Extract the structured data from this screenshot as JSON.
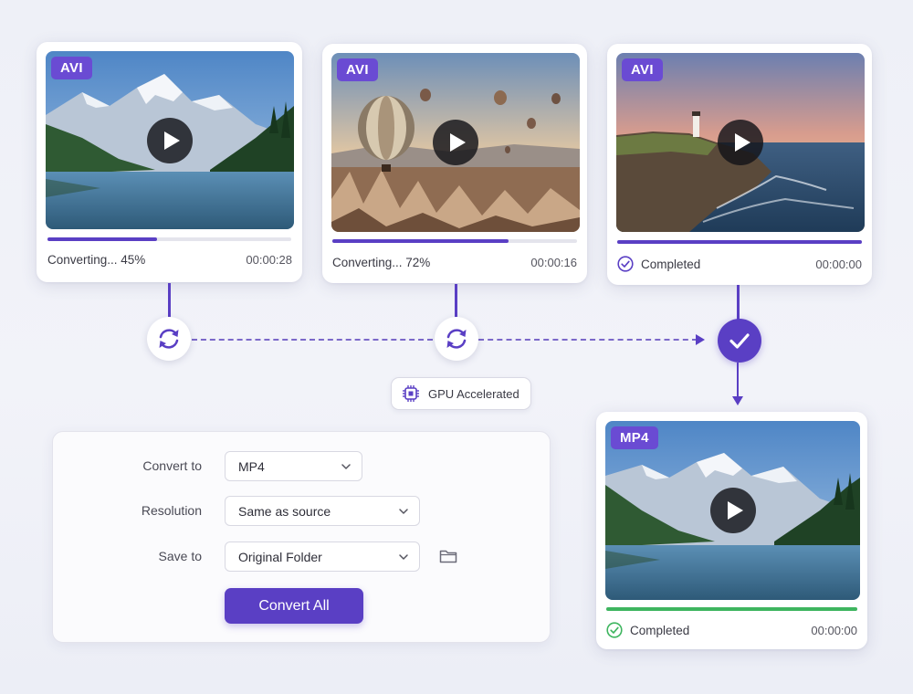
{
  "cards": [
    {
      "format": "AVI",
      "status": "Converting... 45%",
      "time": "00:00:28",
      "progress": 0.45,
      "state": "converting"
    },
    {
      "format": "AVI",
      "status": "Converting... 72%",
      "time": "00:00:16",
      "progress": 0.72,
      "state": "converting"
    },
    {
      "format": "AVI",
      "status": "Completed",
      "time": "00:00:00",
      "progress": 1.0,
      "state": "completed"
    }
  ],
  "output_card": {
    "format": "MP4",
    "status": "Completed",
    "time": "00:00:00",
    "progress": 1.0,
    "state": "completed"
  },
  "gpu_badge": {
    "label": "GPU Accelerated",
    "icon": "chip-icon"
  },
  "settings": {
    "convert_to": {
      "label": "Convert to",
      "value": "MP4"
    },
    "resolution": {
      "label": "Resolution",
      "value": "Same as source"
    },
    "save_to": {
      "label": "Save to",
      "value": "Original Folder"
    },
    "convert_button": "Convert All"
  },
  "colors": {
    "accent": "#5a3fc4",
    "success": "#3eb55f",
    "badge": "#6a4bd3"
  },
  "icons": [
    "play-icon",
    "sync-icon",
    "checkmark-icon",
    "check-circle-icon",
    "chevron-down-icon",
    "folder-icon",
    "chip-icon"
  ]
}
